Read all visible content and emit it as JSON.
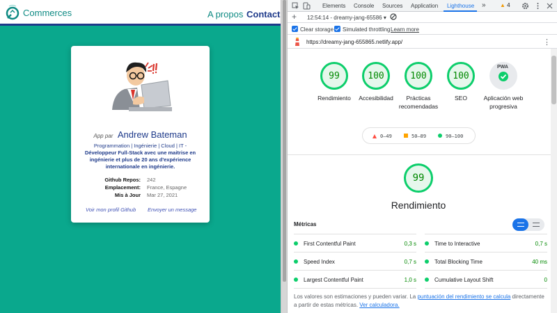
{
  "site": {
    "brand": "Commerces",
    "nav": {
      "apropos": "A propos",
      "contact": "Contact"
    },
    "card": {
      "app_by": "App par",
      "name": "Andrew Bateman",
      "skills_line": "Programmation | Ingénierie | Cloud | IT -",
      "skills_desc": "Développeur Full-Stack avec une maitrise en ingénierie et plus de 20 ans d'expérience internationale en ingénierie.",
      "info": [
        {
          "label": "Github Repos:",
          "value": "242"
        },
        {
          "label": "Emplacement:",
          "value": "France, Espagne"
        },
        {
          "label": "Mis à Jour",
          "value": "Mar 27, 2021"
        }
      ],
      "link_profile": "Voir mon profil Github",
      "link_message": "Envoyer un message"
    },
    "colors": {
      "background": "#0aa88d",
      "accent": "#1e3a8a"
    }
  },
  "devtools": {
    "tabs": [
      "Elements",
      "Console",
      "Sources",
      "Application",
      "Lighthouse"
    ],
    "more_tabs": "»",
    "active_tab": "Lighthouse",
    "warnings": "4",
    "session": "12:54:14 - dreamy-jang-65586 ▾",
    "clear_storage": "Clear storage",
    "simulated_throttling": "Simulated throttling",
    "learn_more": "Learn more",
    "url": "https://dreamy-jang-655865.netlify.app/",
    "scores": [
      {
        "value": "99",
        "label": "Rendimiento"
      },
      {
        "value": "100",
        "label": "Accesibilidad"
      },
      {
        "value": "100",
        "label": "Prácticas recomendadas"
      },
      {
        "value": "100",
        "label": "SEO"
      }
    ],
    "pwa": {
      "badge": "PWA",
      "label": "Aplicación web progresiva"
    },
    "legend": {
      "fail": "0–49",
      "average": "50–89",
      "pass": "90–100"
    },
    "performance": {
      "score": "99",
      "title": "Rendimiento"
    },
    "metrics_title": "Métricas",
    "metrics": [
      {
        "name": "First Contentful Paint",
        "value": "0,3 s"
      },
      {
        "name": "Time to Interactive",
        "value": "0,7 s"
      },
      {
        "name": "Speed Index",
        "value": "0,7 s"
      },
      {
        "name": "Total Blocking Time",
        "value": "40 ms"
      },
      {
        "name": "Largest Contentful Paint",
        "value": "1,0 s"
      },
      {
        "name": "Cumulative Layout Shift",
        "value": "0"
      }
    ],
    "footnote": {
      "pre": "Los valores son estimaciones y pueden variar. La ",
      "link1": "puntuación del rendimiento se calcula",
      "mid": " directamente a partir de estas métricas. ",
      "link2": "Ver calculadora."
    },
    "colors": {
      "pass": "#0cce6b",
      "average": "#ffa400",
      "fail": "#ff4e42",
      "tab_active": "#1a73e8"
    }
  }
}
